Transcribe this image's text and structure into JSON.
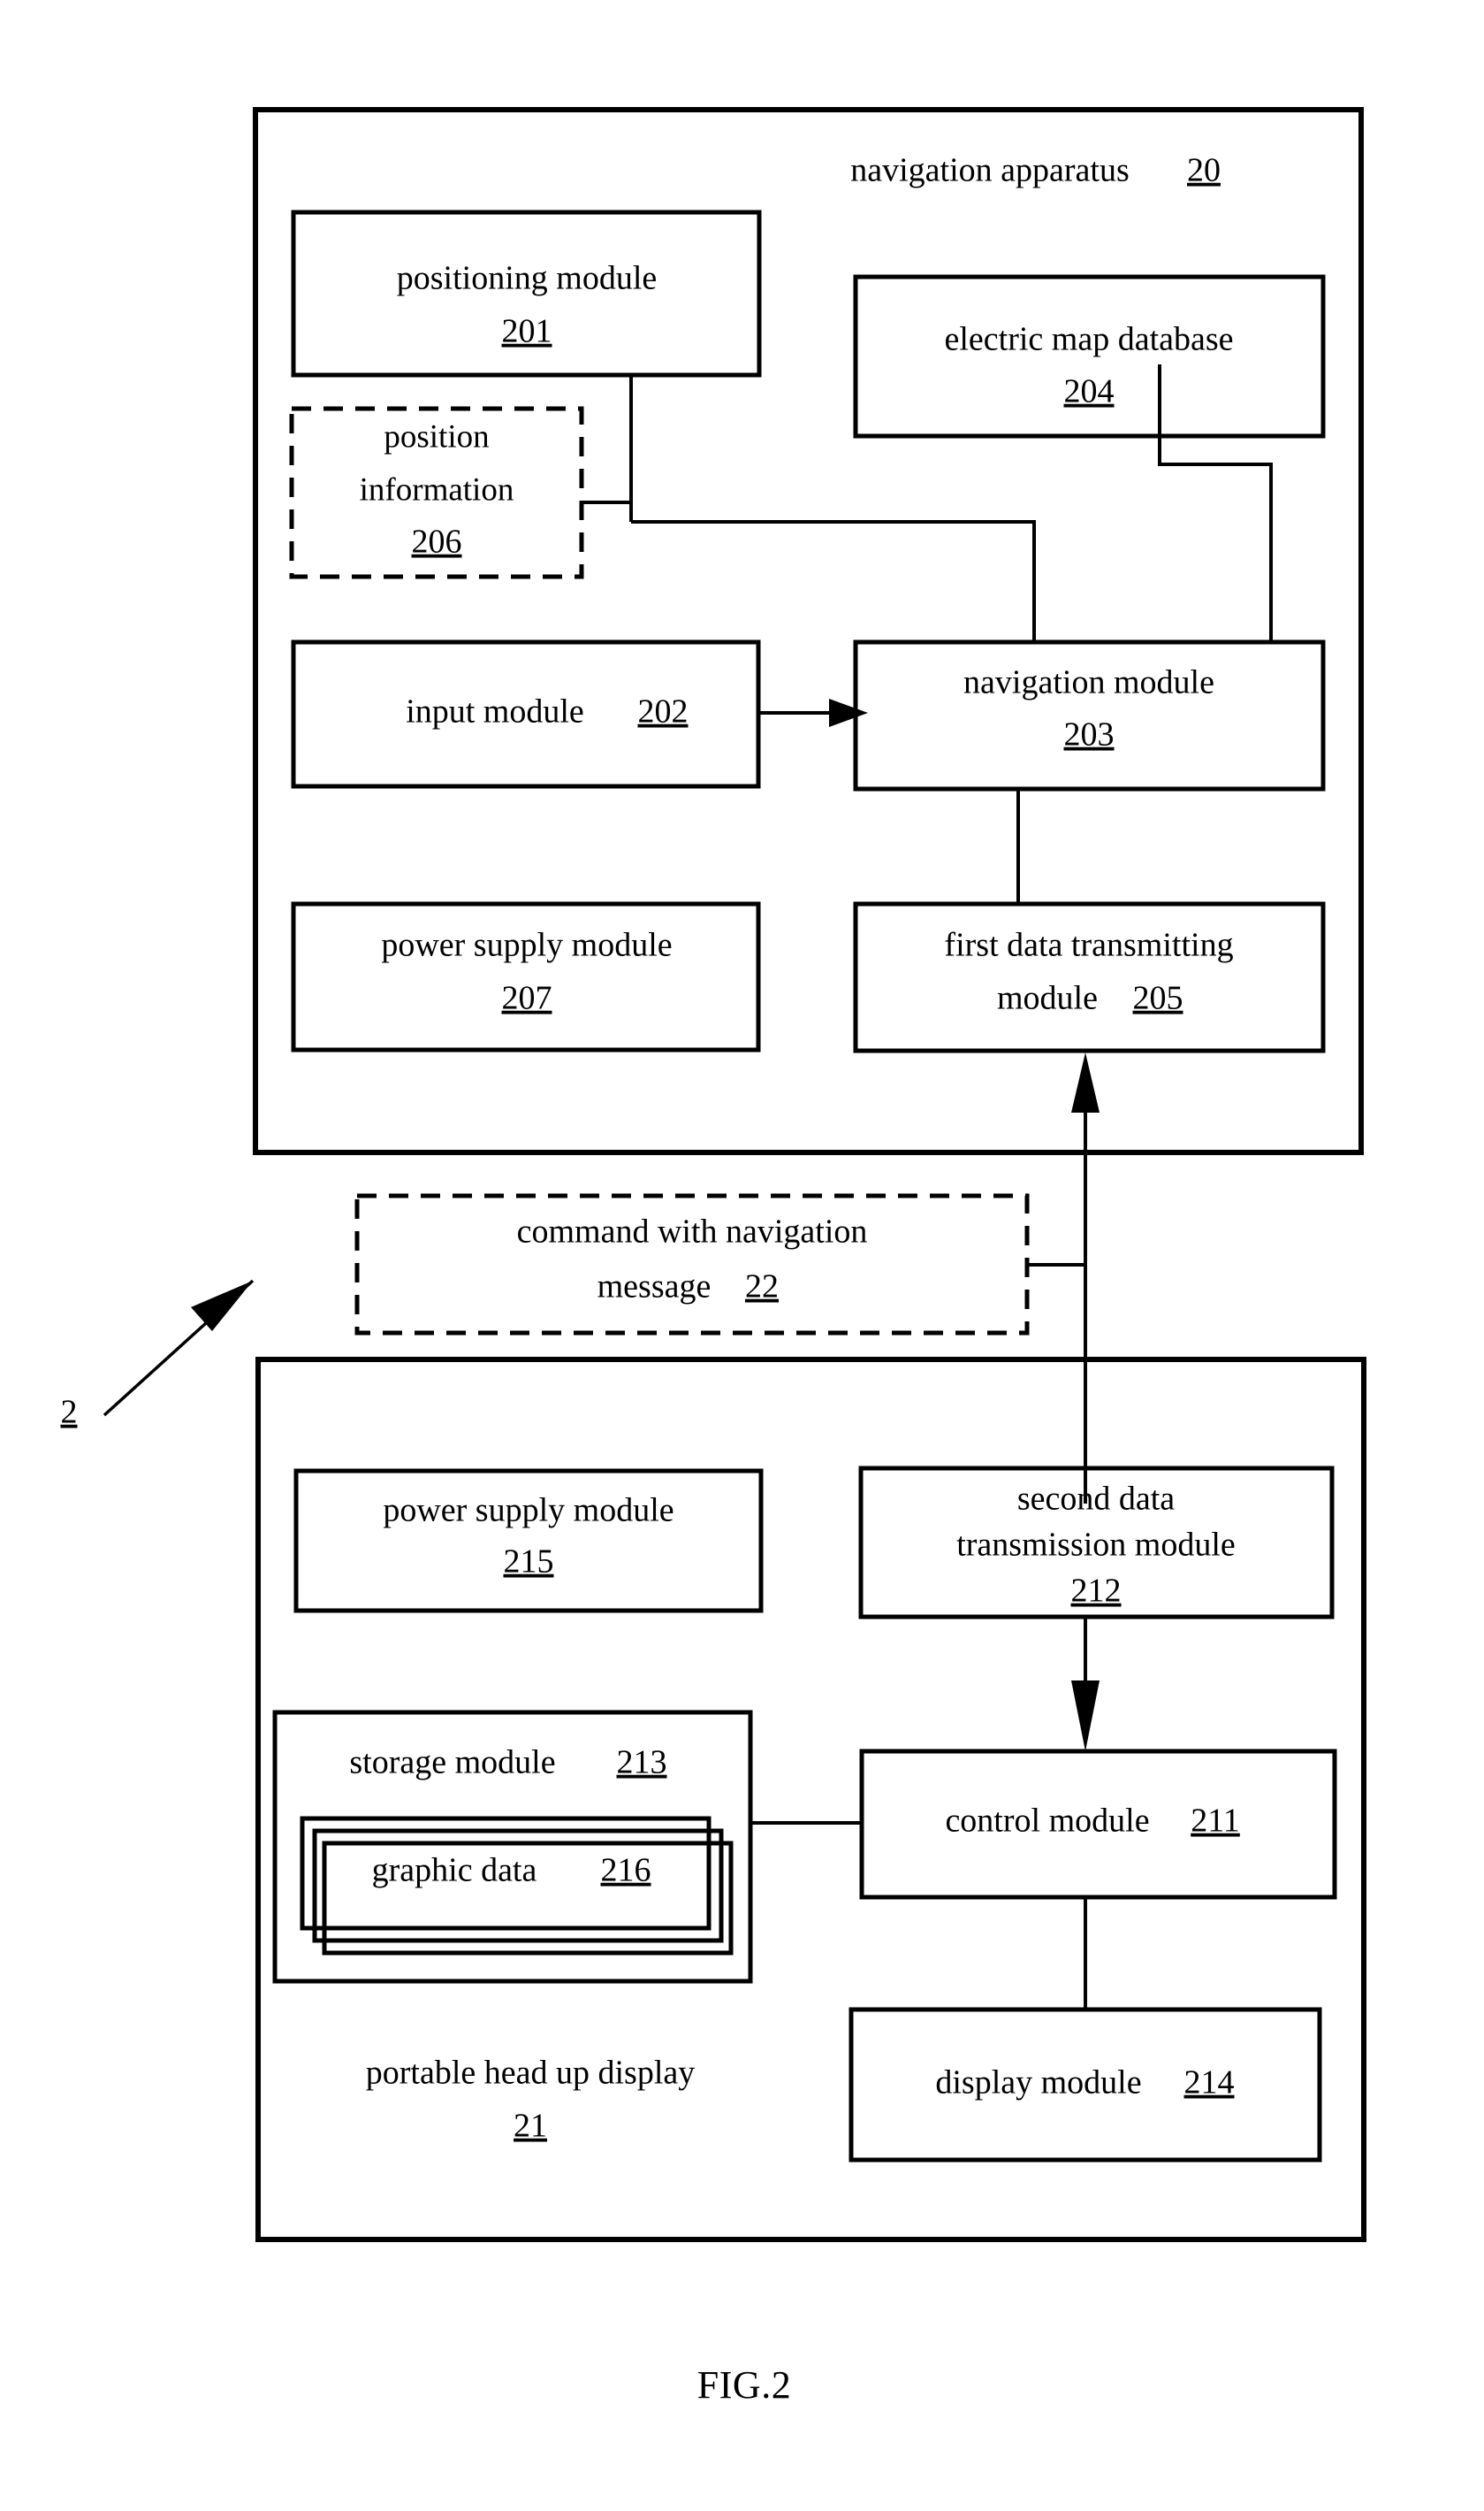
{
  "figure": {
    "caption": "FIG.2",
    "system_ref": "2"
  },
  "navigation_apparatus": {
    "title": "navigation apparatus",
    "ref": "20",
    "blocks": [
      {
        "id": "positioning",
        "label": "positioning module",
        "ref": "201",
        "style": "solid"
      },
      {
        "id": "electric_map",
        "label": "electric map database",
        "ref": "204",
        "style": "solid"
      },
      {
        "id": "position_info",
        "label_line1": "position",
        "label_line2": "information",
        "ref": "206",
        "style": "dashed"
      },
      {
        "id": "input",
        "label": "input module",
        "ref": "202",
        "style": "solid"
      },
      {
        "id": "navigation",
        "label": "navigation module",
        "ref": "203",
        "style": "solid"
      },
      {
        "id": "power_supply_207",
        "label": "power supply module",
        "ref": "207",
        "style": "solid"
      },
      {
        "id": "first_data_tx",
        "label_line1": "first data transmitting",
        "label_line2": "module",
        "ref": "205",
        "style": "solid"
      }
    ]
  },
  "interface": {
    "label_line1": "command with navigation",
    "label_line2": "message",
    "ref": "22",
    "style": "dashed"
  },
  "portable_hud": {
    "title": "portable head up display",
    "ref": "21",
    "blocks": [
      {
        "id": "power_supply_215",
        "label": "power supply module",
        "ref": "215",
        "style": "solid"
      },
      {
        "id": "second_data_tx",
        "label_line1": "second data",
        "label_line2": "transmission module",
        "ref": "212",
        "style": "solid"
      },
      {
        "id": "storage",
        "label": "storage module",
        "ref": "213",
        "style": "solid"
      },
      {
        "id": "graphic_data",
        "label": "graphic data",
        "ref": "216",
        "style": "stacked"
      },
      {
        "id": "control",
        "label": "control module",
        "ref": "211",
        "style": "solid"
      },
      {
        "id": "display",
        "label": "display module",
        "ref": "214",
        "style": "solid"
      }
    ]
  },
  "colors": {
    "ink": "#000000",
    "paper": "#ffffff"
  }
}
